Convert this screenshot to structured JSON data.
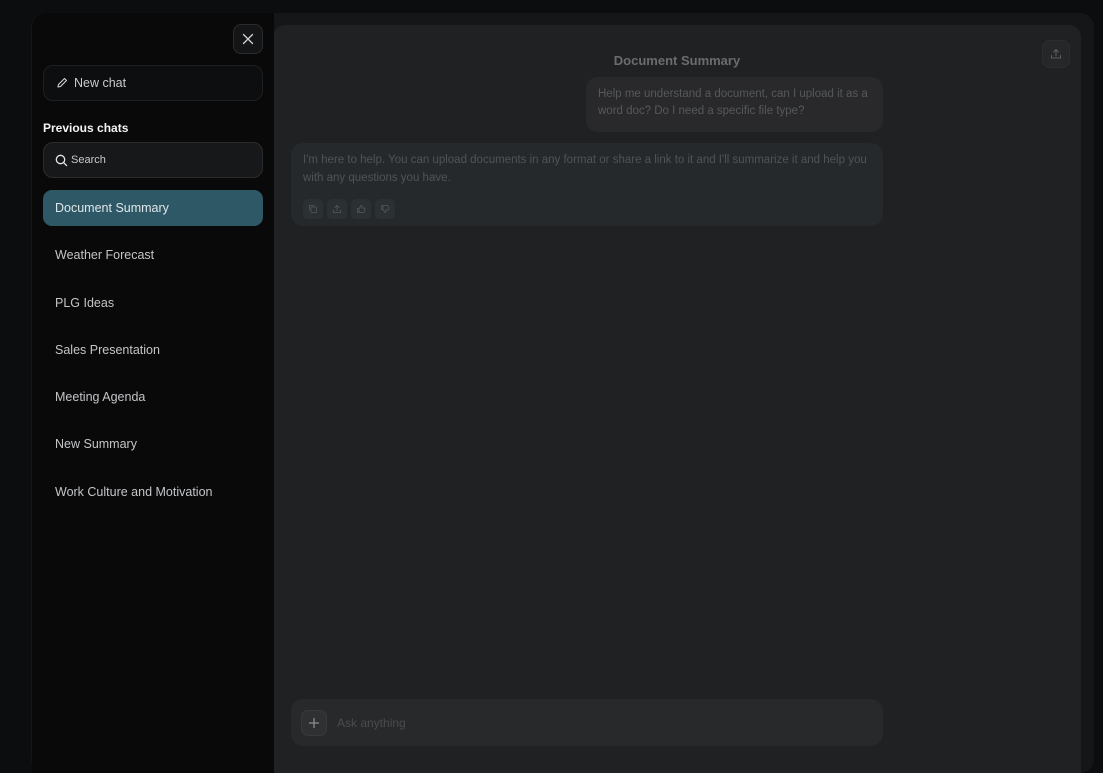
{
  "main": {
    "title": "Document Summary",
    "user_message": "Help me understand a document, can I upload it as a word doc? Do I need a specific file type?",
    "assistant_message": "I'm here to help. You can upload documents in any format or share a link to it and I'll summarize it and help you with any questions you have.",
    "assistant_actions": [
      "copy-icon",
      "share-icon",
      "thumbs-up-icon",
      "thumbs-down-icon"
    ],
    "composer": {
      "placeholder": "Ask anything"
    }
  },
  "sidebar": {
    "new_chat_label": "New chat",
    "previous_title": "Previous chats",
    "search_placeholder": "Search",
    "chats": [
      {
        "label": "Document Summary",
        "active": true
      },
      {
        "label": "Weather Forecast",
        "active": false
      },
      {
        "label": "PLG Ideas",
        "active": false
      },
      {
        "label": "Sales Presentation",
        "active": false
      },
      {
        "label": "Meeting Agenda",
        "active": false
      },
      {
        "label": "New Summary",
        "active": false
      },
      {
        "label": "Work Culture and Motivation",
        "active": false
      }
    ]
  },
  "colors": {
    "background": "#0c0d0e",
    "sidebar": "#09090a",
    "active_item": "#2e5866",
    "main_panel": "#202122"
  }
}
